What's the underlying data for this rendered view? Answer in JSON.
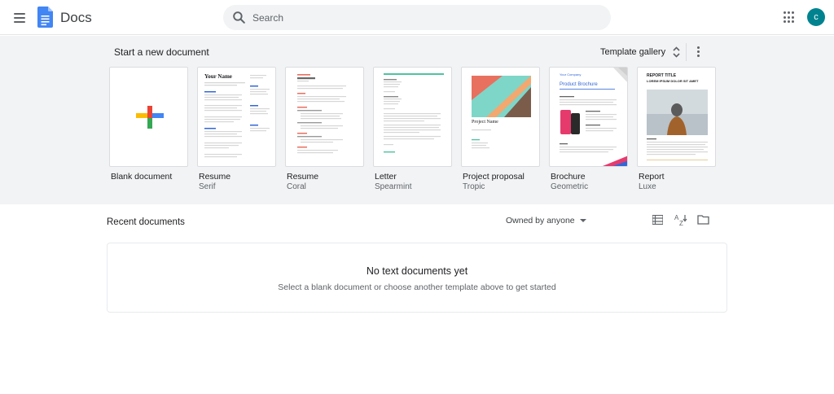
{
  "header": {
    "app_title": "Docs",
    "search_placeholder": "Search",
    "avatar_initial": "c",
    "icons": {
      "menu": "hamburger-icon",
      "logo": "docs-logo-icon",
      "search": "search-icon",
      "apps": "apps-grid-icon"
    },
    "colors": {
      "avatar": "#00838f",
      "docs_blue": "#4285f4"
    }
  },
  "templates": {
    "title": "Start a new document",
    "gallery_label": "Template gallery",
    "items": [
      {
        "name": "Blank document",
        "subtitle": ""
      },
      {
        "name": "Resume",
        "subtitle": "Serif",
        "thumb_text": "Your Name"
      },
      {
        "name": "Resume",
        "subtitle": "Coral"
      },
      {
        "name": "Letter",
        "subtitle": "Spearmint"
      },
      {
        "name": "Project proposal",
        "subtitle": "Tropic",
        "thumb_text": "Project Name"
      },
      {
        "name": "Brochure",
        "subtitle": "Geometric",
        "thumb_text": "Product Brochure",
        "thumb_small": "Your Company"
      },
      {
        "name": "Report",
        "subtitle": "Luxe",
        "thumb_text": "REPORT TITLE",
        "thumb_small": "LOREM IPSUM DOLOR SIT AMET"
      }
    ]
  },
  "recent": {
    "title": "Recent documents",
    "owner_filter": "Owned by anyone",
    "empty_title": "No text documents yet",
    "empty_subtitle": "Select a blank document or choose another template above to get started",
    "icons": {
      "list_view": "list-view-icon",
      "sort": "sort-az-icon",
      "folder": "folder-icon"
    }
  }
}
